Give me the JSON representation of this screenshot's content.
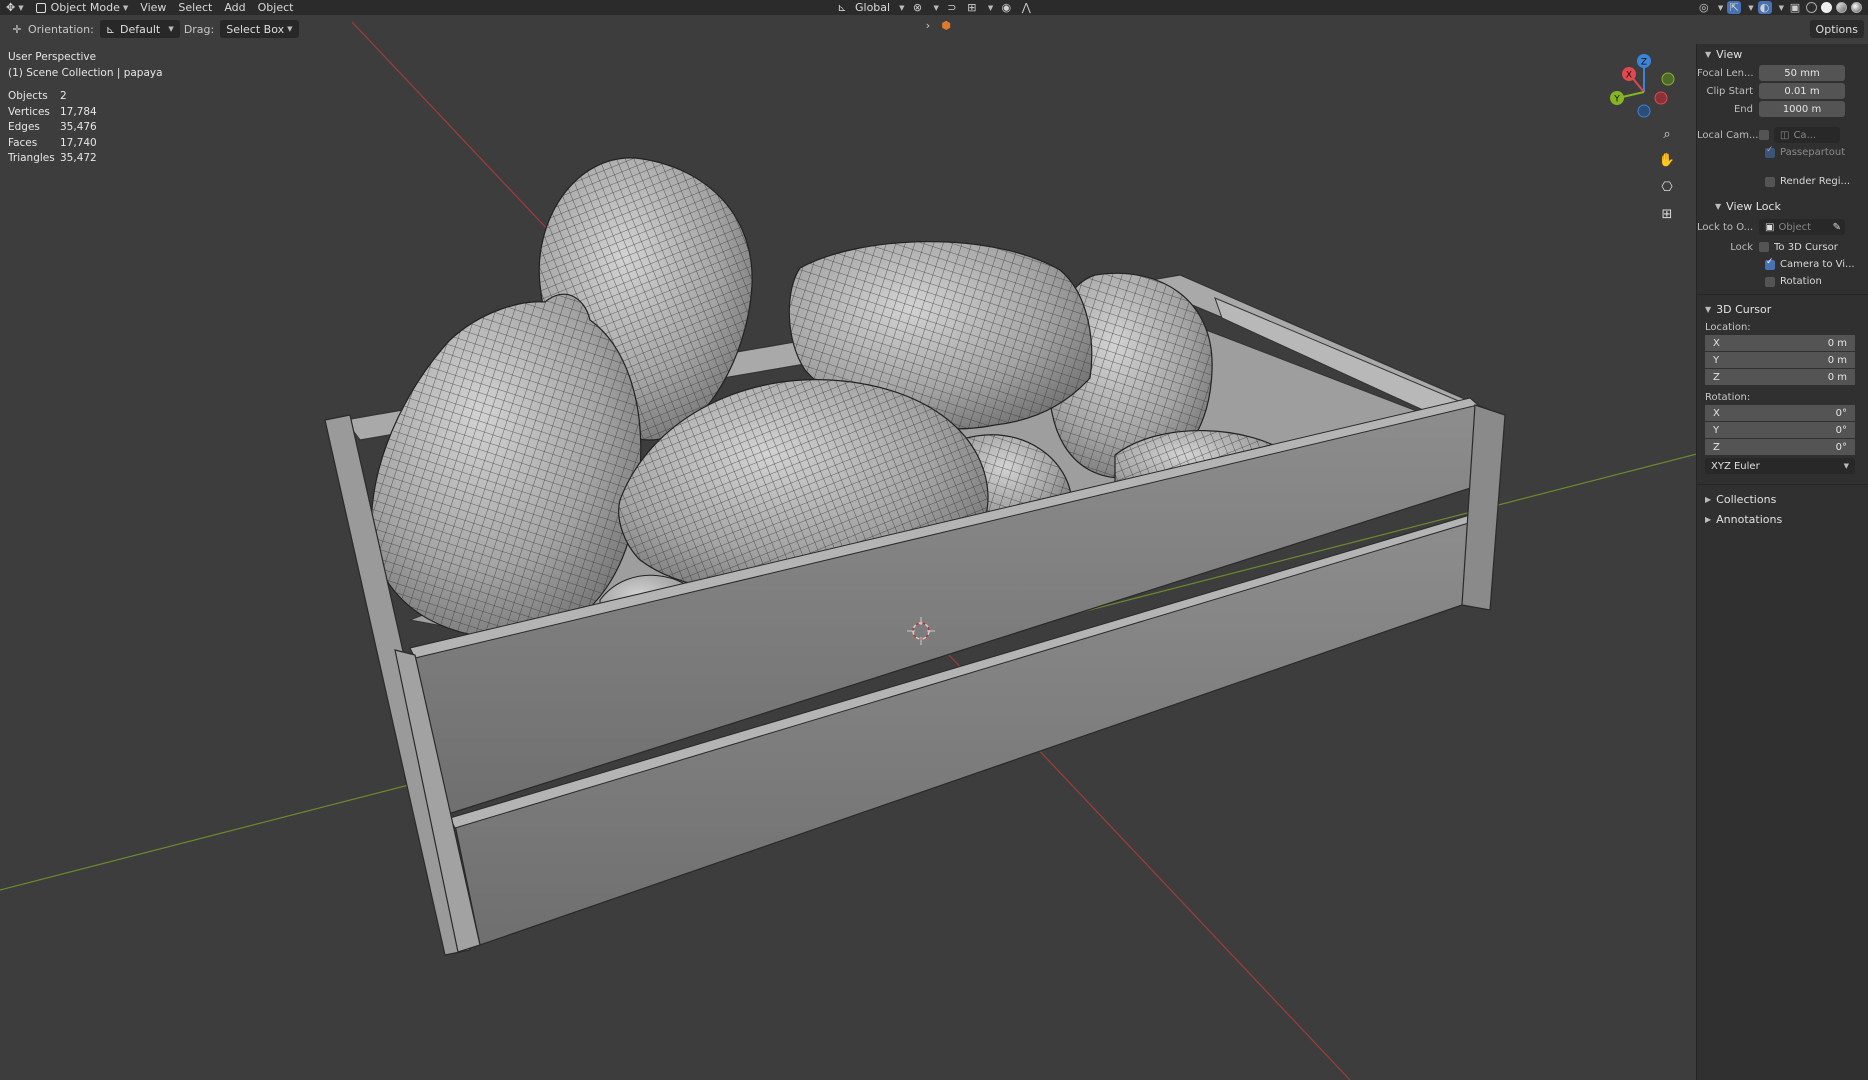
{
  "header": {
    "mode": "Object Mode",
    "menus": [
      "View",
      "Select",
      "Add",
      "Object"
    ],
    "transform_orientation": "Global"
  },
  "toolbar": {
    "orientation_label": "Orientation:",
    "orientation_value": "Default",
    "drag_label": "Drag:",
    "drag_value": "Select Box",
    "options_label": "Options"
  },
  "overlay": {
    "perspective": "User Perspective",
    "collection": "(1) Scene Collection | papaya"
  },
  "stats": [
    {
      "label": "Objects",
      "value": "2"
    },
    {
      "label": "Vertices",
      "value": "17,784"
    },
    {
      "label": "Edges",
      "value": "35,476"
    },
    {
      "label": "Faces",
      "value": "17,740"
    },
    {
      "label": "Triangles",
      "value": "35,472"
    }
  ],
  "gizmo": {
    "x": "X",
    "y": "Y",
    "z": "Z"
  },
  "sidebar": {
    "view": {
      "title": "View",
      "focal_label": "Focal Len...",
      "focal_value": "50 mm",
      "clip_start_label": "Clip Start",
      "clip_start_value": "0.01 m",
      "end_label": "End",
      "end_value": "1000 m",
      "local_cam_label": "Local Cam...",
      "local_cam_value": "Ca...",
      "passepartout": "Passepartout",
      "render_region": "Render Regi..."
    },
    "view_lock": {
      "title": "View Lock",
      "lock_to_label": "Lock to O...",
      "lock_to_value": "Object",
      "lock_label": "Lock",
      "to_cursor": "To 3D Cursor",
      "camera_to_view": "Camera to Vi...",
      "rotation": "Rotation"
    },
    "cursor": {
      "title": "3D Cursor",
      "location_label": "Location:",
      "loc": [
        {
          "axis": "X",
          "value": "0 m"
        },
        {
          "axis": "Y",
          "value": "0 m"
        },
        {
          "axis": "Z",
          "value": "0 m"
        }
      ],
      "rotation_label": "Rotation:",
      "rot": [
        {
          "axis": "X",
          "value": "0°"
        },
        {
          "axis": "Y",
          "value": "0°"
        },
        {
          "axis": "Z",
          "value": "0°"
        }
      ],
      "rotation_mode": "XYZ Euler"
    },
    "collections_title": "Collections",
    "annotations_title": "Annotations"
  },
  "colors": {
    "viewport_bg": "#3d3d3d",
    "accent": "#4772b3",
    "axis_x": "#e0474f",
    "axis_y": "#86b524",
    "axis_z": "#3d83d7"
  }
}
